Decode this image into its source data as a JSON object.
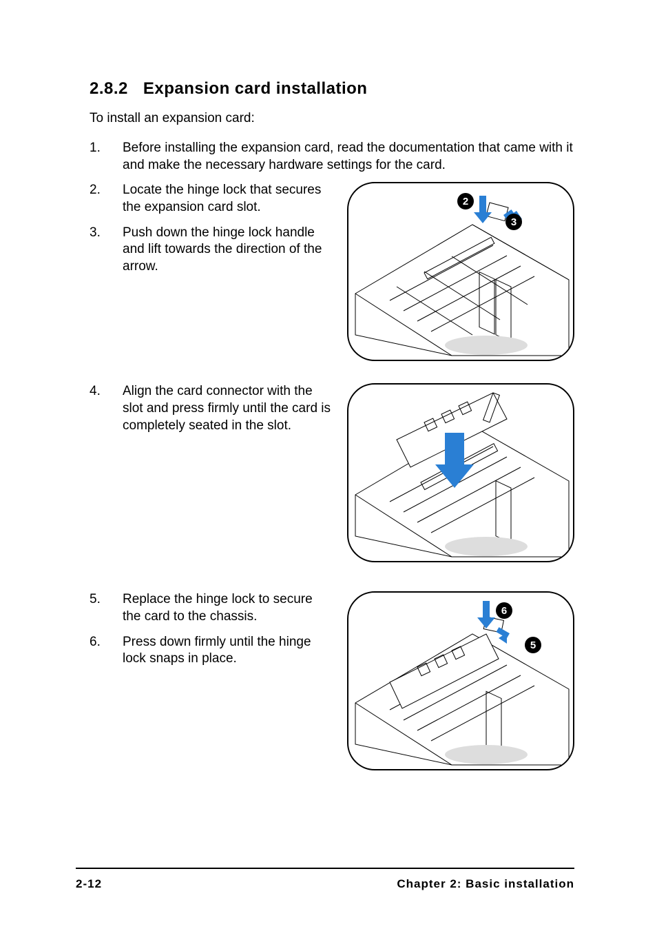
{
  "heading": {
    "number": "2.8.2",
    "title": "Expansion card installation"
  },
  "intro": "To install an expansion card:",
  "steps": [
    "Before installing the expansion card, read the documentation that came with it and make the necessary hardware settings for the card.",
    "Locate the hinge lock that secures the expansion card slot.",
    "Push down the hinge lock handle and lift towards the direction of the arrow.",
    "Align the card connector with the slot and press firmly until the card is completely seated in the slot.",
    "Replace the hinge lock to secure the card to the chassis.",
    "Press down firmly until the hinge lock snaps in place."
  ],
  "figures": [
    {
      "callouts": [
        "2",
        "3"
      ]
    },
    {
      "callouts": []
    },
    {
      "callouts": [
        "6",
        "5"
      ]
    }
  ],
  "footer": {
    "page": "2-12",
    "chapter": "Chapter 2: Basic installation"
  }
}
